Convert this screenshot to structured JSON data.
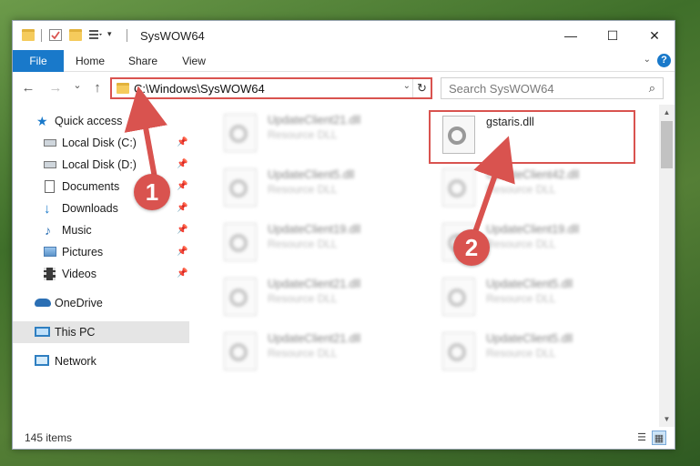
{
  "window": {
    "title": "SysWOW64",
    "minimize": "—",
    "maximize": "☐",
    "close": "✕"
  },
  "ribbon": {
    "tabs": [
      {
        "label": "File"
      },
      {
        "label": "Home"
      },
      {
        "label": "Share"
      },
      {
        "label": "View"
      }
    ],
    "help": "?"
  },
  "nav": {
    "back": "←",
    "forward": "→",
    "recent": "⌄",
    "up": "↑",
    "address": "C:\\Windows\\SysWOW64",
    "search_placeholder": "Search SysWOW64"
  },
  "sidebar": {
    "items": [
      {
        "label": "Quick access",
        "icon": "star-icon"
      },
      {
        "label": "Local Disk (C:)",
        "icon": "drive-icon",
        "pinned": true
      },
      {
        "label": "Local Disk (D:)",
        "icon": "drive-icon",
        "pinned": true
      },
      {
        "label": "Documents",
        "icon": "documents-icon",
        "pinned": true
      },
      {
        "label": "Downloads",
        "icon": "download-icon",
        "pinned": true
      },
      {
        "label": "Music",
        "icon": "music-icon",
        "pinned": true
      },
      {
        "label": "Pictures",
        "icon": "pictures-icon",
        "pinned": true
      },
      {
        "label": "Videos",
        "icon": "videos-icon",
        "pinned": true
      },
      {
        "label": "OneDrive",
        "icon": "cloud-icon"
      },
      {
        "label": "This PC",
        "icon": "computer-icon",
        "selected": true
      },
      {
        "label": "Network",
        "icon": "network-icon"
      }
    ]
  },
  "files": {
    "highlighted": {
      "name": "gstaris.dll"
    },
    "left_column": [
      {
        "name": "UpdateClient21.dll",
        "type": "Resource DLL"
      },
      {
        "name": "UpdateClient5.dll",
        "type": "Resource DLL"
      },
      {
        "name": "UpdateClient19.dll",
        "type": "Resource DLL"
      },
      {
        "name": "UpdateClient21.dll",
        "type": "Resource DLL"
      },
      {
        "name": "UpdateClient21.dll",
        "type": "Resource DLL"
      }
    ],
    "right_column": [
      {
        "name": "UpdateClient42.dll",
        "type": "Resource DLL"
      },
      {
        "name": "UpdateClient19.dll",
        "type": "Resource DLL"
      },
      {
        "name": "UpdateClient5.dll",
        "type": "Resource DLL"
      },
      {
        "name": "UpdateClient5.dll",
        "type": "Resource DLL"
      }
    ]
  },
  "status": {
    "item_count": "145 items"
  },
  "callouts": {
    "step1": "1",
    "step2": "2"
  },
  "colors": {
    "accent": "#1979ca",
    "annotation": "#d9534f",
    "folder": "#f5cb5c"
  }
}
